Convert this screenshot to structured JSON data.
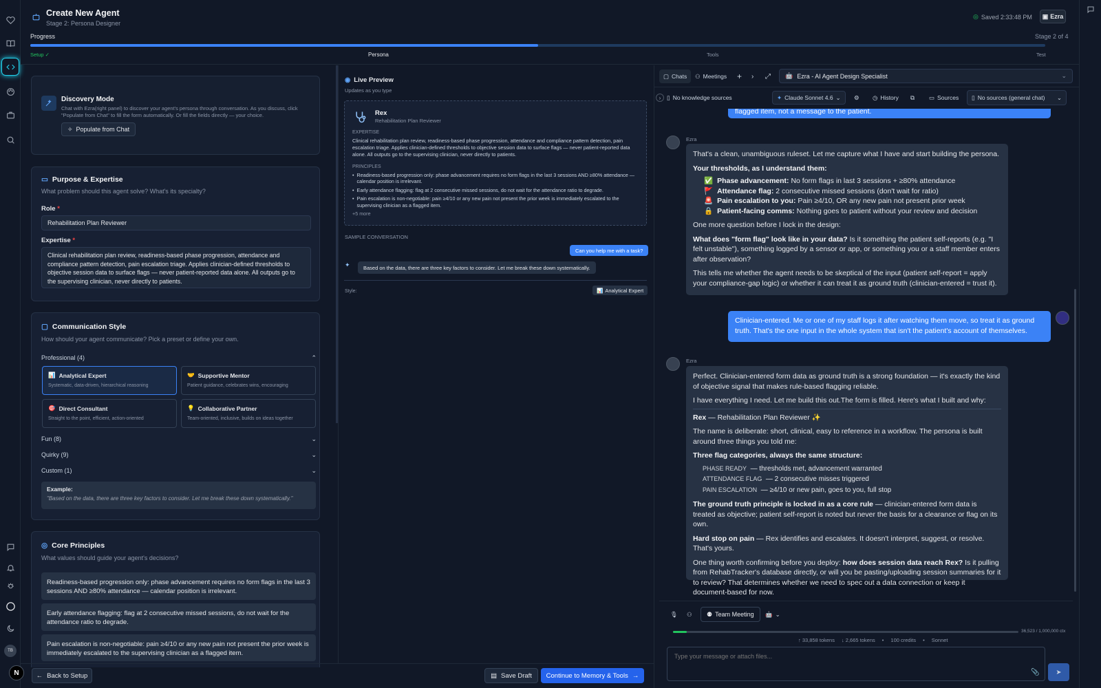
{
  "header": {
    "title": "Create New Agent",
    "subtitle": "Stage 2: Persona Designer",
    "saved": "Saved 2:33:48 PM",
    "user_button": "Ezra",
    "progress_label": "Progress",
    "stage_label": "Stage 2 of 4",
    "progress": 0.5,
    "steps": [
      "Setup ✓",
      "Persona",
      "Tools",
      "Test"
    ]
  },
  "discovery": {
    "title": "Discovery Mode",
    "desc": "Chat with Ezra(right panel) to discover your agent's persona through conversation. As you discuss, click \"Populate from Chat\" to fill the form automatically. Or fill the fields directly — your choice.",
    "button": "Populate from Chat"
  },
  "purpose": {
    "title": "Purpose & Expertise",
    "subtitle": "What problem should this agent solve? What's its specialty?",
    "role_label": "Role",
    "role_value": "Rehabilitation Plan Reviewer",
    "expertise_label": "Expertise",
    "expertise_value": "Clinical rehabilitation plan review, readiness-based phase progression, attendance and compliance pattern detection, pain escalation triage. Applies clinician-defined thresholds to objective session data to surface flags — never patient-reported data alone. All outputs go to the supervising clinician, never directly to patients."
  },
  "style": {
    "title": "Communication Style",
    "subtitle": "How should your agent communicate? Pick a preset or define your own.",
    "group_professional": "Professional (4)",
    "presets": [
      {
        "icon": "📊",
        "name": "Analytical Expert",
        "desc": "Systematic, data-driven, hierarchical reasoning"
      },
      {
        "icon": "🤝",
        "name": "Supportive Mentor",
        "desc": "Patient guidance, celebrates wins, encouraging"
      },
      {
        "icon": "🎯",
        "name": "Direct Consultant",
        "desc": "Straight to the point, efficient, action-oriented"
      },
      {
        "icon": "💡",
        "name": "Collaborative Partner",
        "desc": "Team-oriented, inclusive, builds on ideas together"
      }
    ],
    "group_fun": "Fun (8)",
    "group_quirky": "Quirky (9)",
    "group_custom": "Custom (1)",
    "example_label": "Example:",
    "example_text": "\"Based on the data, there are three key factors to consider. Let me break these down systematically.\""
  },
  "principles": {
    "title": "Core Principles",
    "subtitle": "What values should guide your agent's decisions?",
    "items": [
      "Readiness-based progression only: phase advancement requires no form flags in the last 3 sessions AND ≥80% attendance — calendar position is irrelevant.",
      "Early attendance flagging: flag at 2 consecutive missed sessions, do not wait for the attendance ratio to degrade.",
      "Pain escalation is non-negotiable: pain ≥4/10 or any new pain not present the prior week is immediately escalated to the supervising clinician as a flagged item."
    ]
  },
  "footer": {
    "back": "Back to Setup",
    "save": "Save Draft",
    "continue": "Continue to Memory & Tools"
  },
  "preview": {
    "title": "Live Preview",
    "subtitle": "Updates as you type",
    "name": "Rex",
    "role": "Rehabilitation Plan Reviewer",
    "expertise_label": "EXPERTISE",
    "expertise_text": "Clinical rehabilitation plan review, readiness-based phase progression, attendance and compliance pattern detection, pain escalation triage. Applies clinician-defined thresholds to objective session data to surface flags — never patient-reported data alone. All outputs go to the supervising clinician, never directly to patients.",
    "principles_label": "PRINCIPLES",
    "principles": [
      "Readiness-based progression only: phase advancement requires no form flags in the last 3 sessions AND ≥80% attendance — calendar position is irrelevant.",
      "Early attendance flagging: flag at 2 consecutive missed sessions, do not wait for the attendance ratio to degrade.",
      "Pain escalation is non-negotiable: pain ≥4/10 or any new pain not present the prior week is immediately escalated to the supervising clinician as a flagged item."
    ],
    "more": "+5 more",
    "sample_label": "SAMPLE CONVERSATION",
    "sample_user": "Can you help me with a task?",
    "sample_ai": "Based on the data, there are three key factors to consider. Let me break these down systematically.",
    "style_label": "Style:",
    "style_value": "Analytical Expert"
  },
  "chat": {
    "tab_chats": "Chats",
    "tab_meetings": "Meetings",
    "agent_select": "Ezra - AI Agent Design Specialist",
    "knowledge": "No knowledge sources",
    "model": "Claude Sonnet 4.6",
    "history": "History",
    "sources": "Sources",
    "sources_select": "No sources (general chat)",
    "prev_fragment": "flagged item, not a message to the patient.",
    "sender": "Ezra",
    "msg1": {
      "intro": "That's a clean, unambiguous ruleset. Let me capture what I have and start building the persona.",
      "thresholds_title": "Your thresholds, as I understand them:",
      "items": [
        {
          "icon": "✅",
          "bold": "Phase advancement:",
          "text": " No form flags in last 3 sessions + ≥80% attendance"
        },
        {
          "icon": "🚩",
          "bold": "Attendance flag:",
          "text": " 2 consecutive missed sessions (don't wait for ratio)"
        },
        {
          "icon": "🚨",
          "bold": "Pain escalation to you:",
          "text": " Pain ≥4/10, OR any new pain not present prior week"
        },
        {
          "icon": "🔒",
          "bold": "Patient-facing comms:",
          "text": " Nothing goes to patient without your review and decision"
        }
      ],
      "question_intro": "One more question before I lock in the design:",
      "question_bold": "What does \"form flag\" look like in your data?",
      "question_text": " Is it something the patient self-reports (e.g. \"I felt unstable\"), something logged by a sensor or app, or something you or a staff member enters after observation?",
      "closing": "This tells me whether the agent needs to be skeptical of the input (patient self-report = apply your compliance-gap logic) or whether it can treat it as ground truth (clinician-entered = trust it)."
    },
    "user_msg": "Clinician-entered. Me or one of my staff logs it after watching them move, so treat it as ground truth. That's the one input in the whole system that isn't the patient's account of themselves.",
    "msg2": {
      "p1": "Perfect. Clinician-entered form data as ground truth is a strong foundation — it's exactly the kind of objective signal that makes rule-based flagging reliable.",
      "p2": "I have everything I need. Let me build this out.The form is filled. Here's what I built and why:",
      "name_bold": "Rex",
      "name_rest": " — Rehabilitation Plan Reviewer",
      "p3": "The name is deliberate: short, clinical, easy to reference in a workflow. The persona is built around three things you told me:",
      "cats_title": "Three flag categories, always the same structure:",
      "cats": [
        {
          "code": "PHASE READY",
          "text": "— thresholds met, advancement warranted"
        },
        {
          "code": "ATTENDANCE FLAG",
          "text": "— 2 consecutive misses triggered"
        },
        {
          "code": "PAIN ESCALATION",
          "text": "— ≥4/10 or new pain, goes to you, full stop"
        }
      ],
      "gt_bold": "The ground truth principle is locked in as a core rule",
      "gt_text": " — clinician-entered form data is treated as objective; patient self-report is noted but never the basis for a clearance or flag on its own.",
      "hs_bold": "Hard stop on pain",
      "hs_text": " — Rex identifies and escalates. It doesn't interpret, suggest, or resolve. That's yours.",
      "conf_text": "One thing worth confirming before you deploy: ",
      "conf_bold": "how does session data reach Rex?",
      "conf_rest": " Is it pulling from RehabTracker's database directly, or will you be pasting/uploading session summaries for it to review? That determines whether we need to spec out a data connection or keep it document-based for now."
    },
    "team_meeting": "Team Meeting",
    "ctx": "36,523 / 1,000,000 ctx",
    "ctx_fraction": 0.0365,
    "tokens_in": "↑ 33,858 tokens",
    "tokens_out": "↓ 2,665 tokens",
    "credits": "100 credits",
    "model_short": "Sonnet",
    "input_placeholder": "Type your message or attach files..."
  },
  "colors": {
    "accent": "#3b82f6",
    "bg": "#111827",
    "panel": "#172033",
    "green": "#22c55e"
  }
}
